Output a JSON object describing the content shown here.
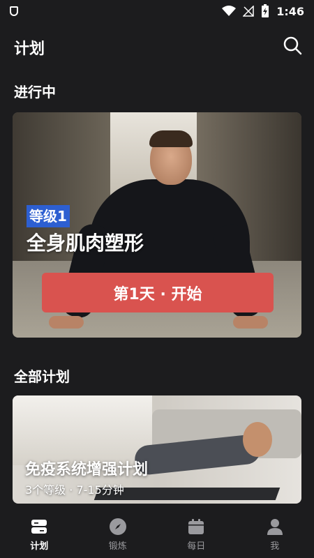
{
  "status_bar": {
    "time": "1:46"
  },
  "header": {
    "title": "计划"
  },
  "in_progress": {
    "section_title": "进行中",
    "card": {
      "level_badge": "等级1",
      "plan_name": "全身肌肉塑形",
      "start_button": "第1天 · 开始"
    }
  },
  "all_plans": {
    "section_title": "全部计划",
    "card": {
      "title": "免疫系统增强计划",
      "subtitle": "3个等级 · 7-15分钟"
    }
  },
  "tab_bar": {
    "tabs": [
      {
        "label": "计划",
        "icon": "plan-icon",
        "active": true
      },
      {
        "label": "锻炼",
        "icon": "compass-icon",
        "active": false
      },
      {
        "label": "每日",
        "icon": "calendar-icon",
        "active": false
      },
      {
        "label": "我",
        "icon": "profile-icon",
        "active": false
      }
    ]
  },
  "colors": {
    "background": "#1c1c1e",
    "accent_red": "#d9534f",
    "badge_blue": "#2d5fd1",
    "inactive_tab": "#9a9a9e"
  }
}
